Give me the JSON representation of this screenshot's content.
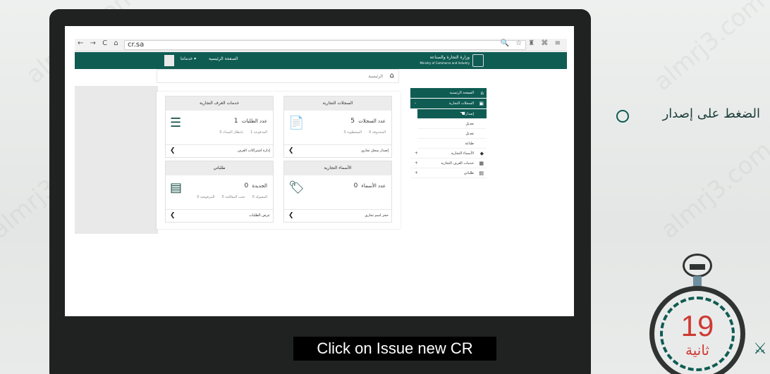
{
  "browser": {
    "nav_icons": "← → C ⌂",
    "url": "cr.sa",
    "extension_icons": "🔍 ☆ ♜ ⌘ ≡"
  },
  "site": {
    "topbar": {
      "menu_main": "الصفحة الرئيسية",
      "menu_services": "خدماتنا ▾",
      "logo_text": "وزارة التجارة والصناعة",
      "logo_sub": "Ministry of Commerce and Industry"
    },
    "breadcrumb": {
      "home_icon": "⌂",
      "text": "الرئيسية"
    },
    "cards": [
      {
        "title": "السجلات التجارية",
        "icon": "📄",
        "count_label": "عدد السجلات",
        "count_value": "5",
        "sub_left": "المشطوبة 3",
        "sub_right": "المحذوفة 0",
        "footer_link": "إصدار سجل تجاري",
        "footer_arrow": "❮"
      },
      {
        "title": "خدمات الغرف التجارية",
        "icon": "☰",
        "count_label": "عدد الطلبات",
        "count_value": "1",
        "sub_left": "بانتظار السداد 0",
        "sub_right": "المدفوعة 1",
        "footer_link": "إدارة اشتراكات الغرف",
        "footer_arrow": "❮"
      },
      {
        "title": "الأسماء التجارية",
        "icon": "🏷",
        "count_label": "عدد الأسماء",
        "count_value": "0",
        "sub_left": "",
        "sub_right": "",
        "footer_link": "حجز اسم تجاري",
        "footer_arrow": "❮"
      },
      {
        "title": "طلباتي",
        "icon": "▤",
        "count_label": "الجديدة",
        "count_value": "0",
        "sub_left": "المرفوضة 0",
        "sub_right": "تحت المعالجة 0",
        "extra": "المقبولة 0",
        "footer_link": "عرض الطلبات",
        "footer_arrow": "❮"
      }
    ],
    "side_nav": {
      "home": "الصفحة الرئيسية",
      "home_icon": "⌂",
      "cr": "السجلات التجارية",
      "cr_icon": "▣",
      "cr_caret": "-",
      "cr_sub": [
        "إصدار",
        "تعديل",
        "تعديل",
        "طباعة"
      ],
      "names": "الأسماء التجارية",
      "names_icon": "◆",
      "names_caret": "+",
      "chambers": "خدمات الغرف التجارية",
      "chambers_icon": "▦",
      "chambers_caret": "+",
      "myreq": "طلباتي",
      "myreq_icon": "▤",
      "myreq_caret": "+",
      "hand_icon": "☚"
    }
  },
  "step": {
    "text": "الضغط على إصدار"
  },
  "subtitle": "Click on Issue new CR",
  "timer": {
    "value": "19",
    "unit": "ثانية"
  },
  "watermark": "almrj3.com",
  "emblem": "⚔"
}
